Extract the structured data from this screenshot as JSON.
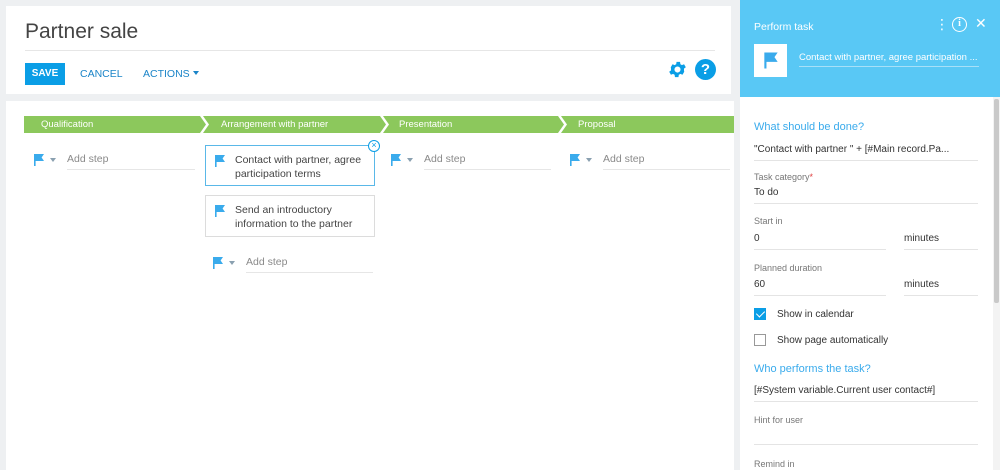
{
  "page": {
    "title": "Partner sale",
    "toolbar": {
      "save_label": "SAVE",
      "cancel_label": "CANCEL",
      "actions_label": "ACTIONS"
    },
    "icons": {
      "settings": "gear-icon",
      "help": "help-icon"
    },
    "help_glyph": "?"
  },
  "colors": {
    "accent": "#0a9ee6",
    "stage_green": "#8cc85c",
    "panel_header": "#59c8f5"
  },
  "stages": [
    {
      "label": "Qualification"
    },
    {
      "label": "Arrangement with partner"
    },
    {
      "label": "Presentation"
    },
    {
      "label": "Proposal"
    }
  ],
  "steps": {
    "add_placeholder": "Add step",
    "arrangement": [
      {
        "text": "Contact with partner, agree participation terms",
        "selected": true
      },
      {
        "text": "Send an introductory information to the partner",
        "selected": false
      }
    ]
  },
  "panel": {
    "title": "Perform task",
    "subject": "Contact with partner, agree participation ...",
    "info_glyph": "i",
    "close_glyph": "✕",
    "what_heading": "What should be done?",
    "what_value": "\"Contact with partner \" + [#Main record.Pa...",
    "task_category_label": "Task category",
    "task_category_value": "To do",
    "start_in_label": "Start in",
    "start_in_value": "0",
    "start_in_unit": "minutes",
    "duration_label": "Planned duration",
    "duration_value": "60",
    "duration_unit": "minutes",
    "show_calendar_label": "Show in calendar",
    "show_calendar_checked": true,
    "show_page_label": "Show page automatically",
    "show_page_checked": false,
    "who_heading": "Who performs the task?",
    "who_value": "[#System variable.Current user contact#]",
    "hint_label": "Hint for user",
    "hint_value": "",
    "remind_label": "Remind in"
  }
}
